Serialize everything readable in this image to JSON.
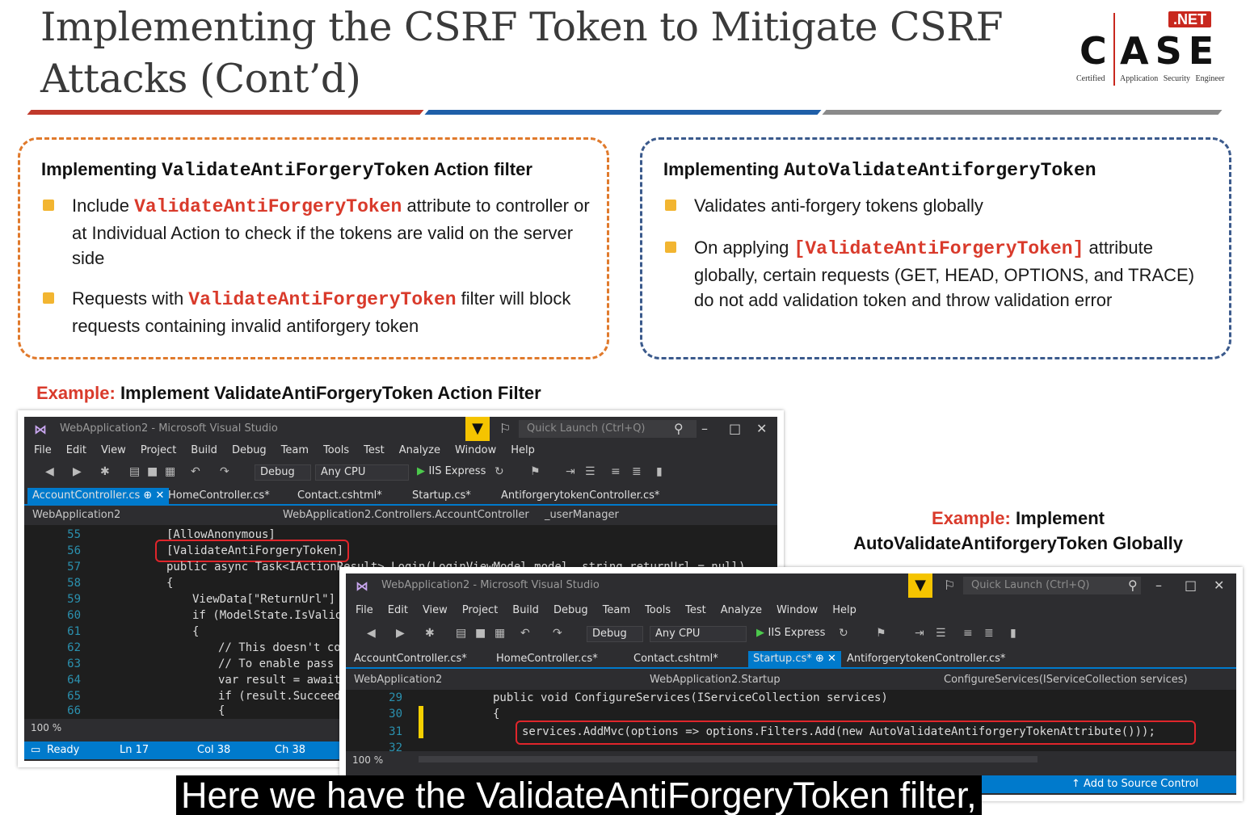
{
  "slide": {
    "title": "Implementing the CSRF Token to Mitigate CSRF Attacks (Cont’d)",
    "logo": {
      "net": ".NET",
      "c": "C",
      "ase": "ASE",
      "certified": "Certified",
      "subtitle": "Application Security Engineer"
    },
    "colors": {
      "stripe_red": "#c0392b",
      "stripe_blue": "#1f5fa8",
      "stripe_gray": "#8a8a8a",
      "accent_red": "#d93a2b",
      "bullet": "#f2b531"
    }
  },
  "left_box": {
    "heading_prefix": "Implementing ",
    "heading_code": "ValidateAntiForgeryToken",
    "heading_suffix": " Action filter",
    "bullet1_prefix": "Include ",
    "bullet1_code": "ValidateAntiForgeryToken",
    "bullet1_suffix": " attribute to controller or at Individual Action to check if the tokens are valid on the server side",
    "bullet2_prefix": "Requests with ",
    "bullet2_code": "ValidateAntiForgeryToken",
    "bullet2_suffix": " filter will block requests containing invalid antiforgery token"
  },
  "right_box": {
    "heading_prefix": "Implementing ",
    "heading_code": "AutoValidateAntiforgeryToken",
    "bullet1": "Validates anti-forgery tokens globally",
    "bullet2_prefix": "On applying ",
    "bullet2_code": "[ValidateAntiForgeryToken]",
    "bullet2_suffix": " attribute globally, certain requests (GET, HEAD, OPTIONS, and TRACE) do not add validation token and throw validation error"
  },
  "example1": {
    "label": "Example:",
    "text": " Implement ValidateAntiForgeryToken Action Filter"
  },
  "example2": {
    "label": "Example:",
    "text": " Implement AutoValidateAntiforgeryToken Globally"
  },
  "vs_common": {
    "window_title": "WebApplication2 - Microsoft Visual Studio",
    "quick_launch": "Quick Launch (Ctrl+Q)",
    "menu": [
      "File",
      "Edit",
      "View",
      "Project",
      "Build",
      "Debug",
      "Team",
      "Tools",
      "Test",
      "Analyze",
      "Window",
      "Help"
    ],
    "config": "Debug",
    "platform": "Any CPU",
    "run": "IIS Express",
    "zoom": "100 %"
  },
  "vs1": {
    "tabs": [
      "AccountController.cs",
      "HomeController.cs*",
      "Contact.cshtml*",
      "Startup.cs*",
      "AntiforgerytokenController.cs*"
    ],
    "project": "WebApplication2",
    "class": "WebApplication2.Controllers.AccountController",
    "member": "_userManager",
    "lines": [
      {
        "n": "55",
        "text": "[AllowAnonymous]"
      },
      {
        "n": "56",
        "text": "[ValidateAntiForgeryToken]"
      },
      {
        "n": "57",
        "text": "public async Task<IActionResult> Login(LoginViewModel model, string returnUrl = null)"
      },
      {
        "n": "58",
        "text": "{"
      },
      {
        "n": "59",
        "text": "ViewData[\"ReturnUrl\"]"
      },
      {
        "n": "60",
        "text": "if (ModelState.IsValid"
      },
      {
        "n": "61",
        "text": "{"
      },
      {
        "n": "62",
        "text": "// This doesn't co"
      },
      {
        "n": "63",
        "text": "// To enable pass"
      },
      {
        "n": "64",
        "text": "var result = await"
      },
      {
        "n": "65",
        "text": "if (result.Succeed"
      },
      {
        "n": "66",
        "text": "{"
      }
    ],
    "status": {
      "ready": "Ready",
      "ln": "Ln 17",
      "col": "Col 38",
      "ch": "Ch 38"
    }
  },
  "vs2": {
    "tabs": [
      "AccountController.cs*",
      "HomeController.cs*",
      "Contact.cshtml*",
      "Startup.cs*",
      "AntiforgerytokenController.cs*"
    ],
    "project": "WebApplication2",
    "class": "WebApplication2.Startup",
    "member": "ConfigureServices(IServiceCollection services)",
    "lines": [
      {
        "n": "29",
        "text": "public void ConfigureServices(IServiceCollection services)"
      },
      {
        "n": "30",
        "text": "{"
      },
      {
        "n": "31",
        "text": "services.AddMvc(options => options.Filters.Add(new AutoValidateAntiforgeryTokenAttribute()));"
      },
      {
        "n": "32",
        "text": ""
      }
    ],
    "source_control": "Add to Source Control"
  },
  "caption": "Here we have the ValidateAntiForgeryToken filter,"
}
